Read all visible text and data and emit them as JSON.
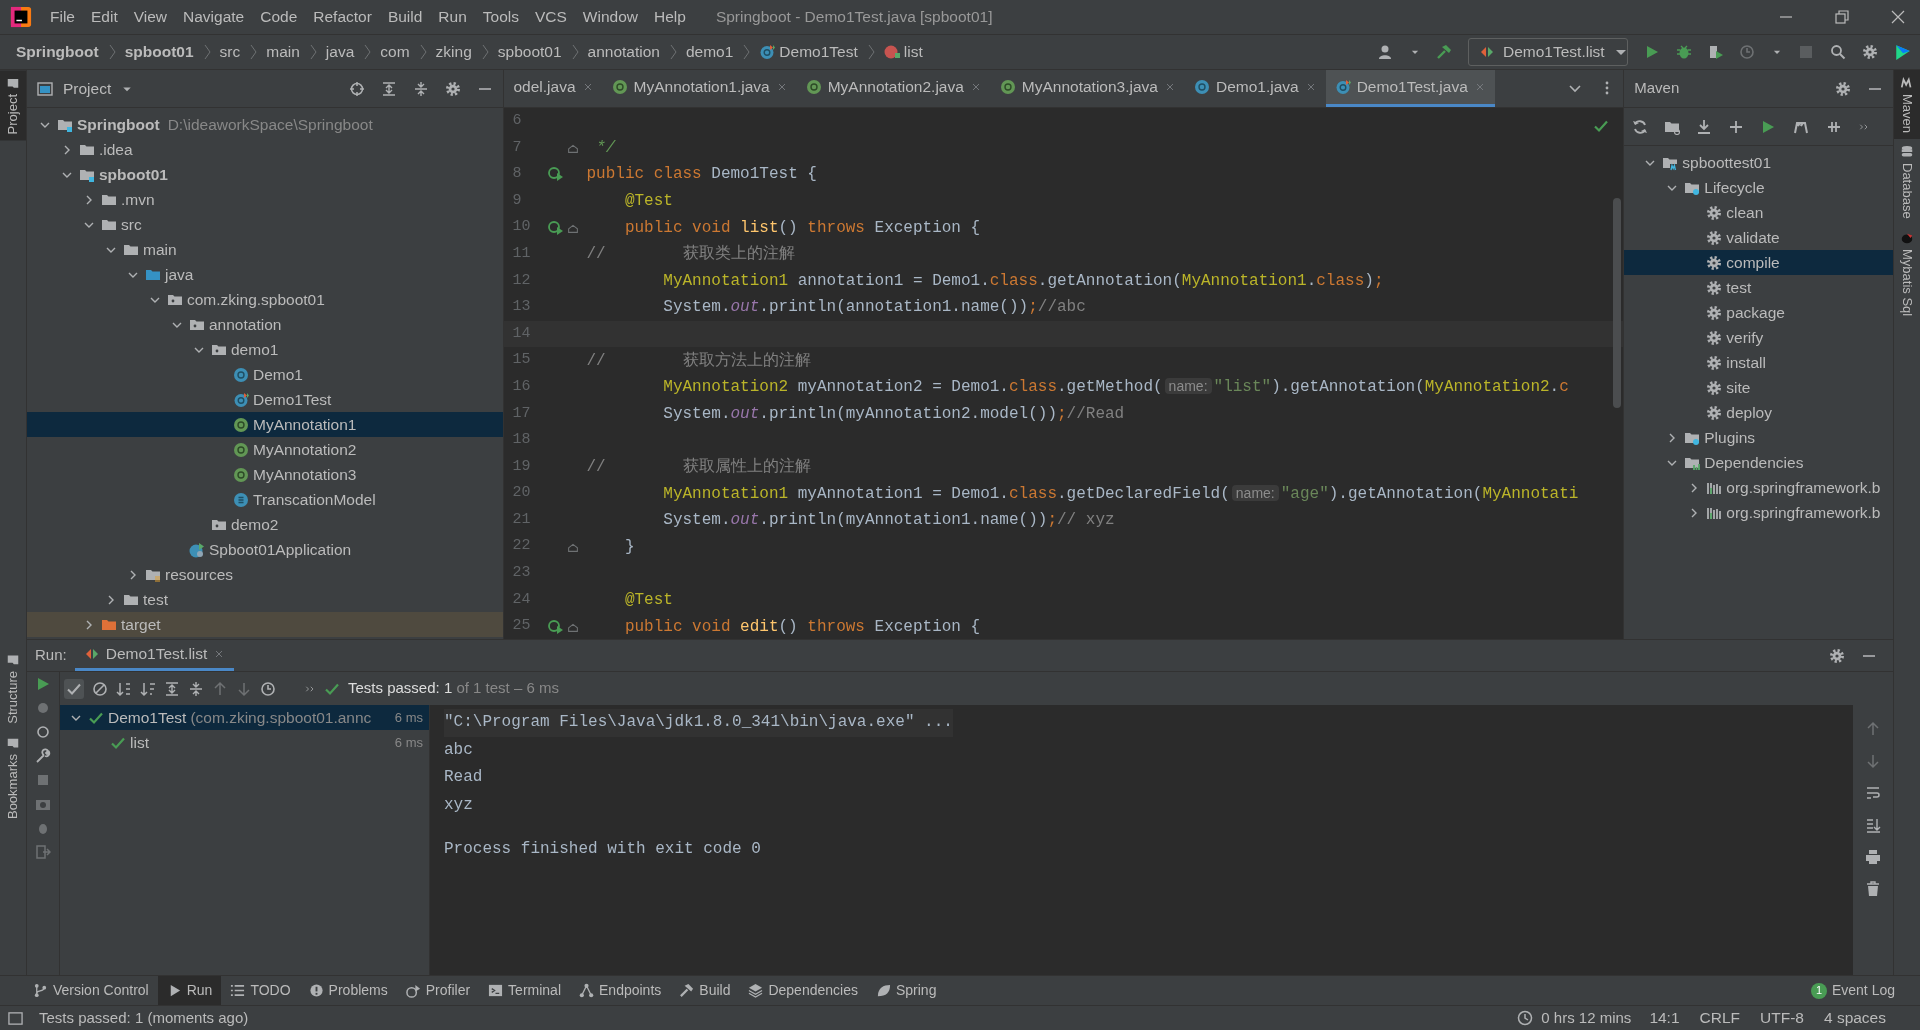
{
  "window": {
    "title": "Springboot - Demo1Test.java [spboot01]"
  },
  "menu": [
    "File",
    "Edit",
    "View",
    "Navigate",
    "Code",
    "Refactor",
    "Build",
    "Run",
    "Tools",
    "VCS",
    "Window",
    "Help"
  ],
  "breadcrumbs": [
    {
      "label": "Springboot",
      "bold": true,
      "kind": "folder"
    },
    {
      "label": "spboot01",
      "bold": true,
      "kind": "folder"
    },
    {
      "label": "src",
      "bold": false,
      "kind": "folder"
    },
    {
      "label": "main",
      "bold": false,
      "kind": "folder"
    },
    {
      "label": "java",
      "bold": false,
      "kind": "folder"
    },
    {
      "label": "com",
      "bold": false,
      "kind": "folder"
    },
    {
      "label": "zking",
      "bold": false,
      "kind": "folder"
    },
    {
      "label": "spboot01",
      "bold": false,
      "kind": "folder"
    },
    {
      "label": "annotation",
      "bold": false,
      "kind": "folder"
    },
    {
      "label": "demo1",
      "bold": false,
      "kind": "folder"
    },
    {
      "label": "Demo1Test",
      "bold": false,
      "kind": "class"
    },
    {
      "label": "list",
      "bold": false,
      "kind": "method"
    }
  ],
  "run_config": {
    "label": "Demo1Test.list"
  },
  "left_stripe": [
    {
      "label": "Project",
      "selected": true
    },
    {
      "label": "Structure",
      "selected": false
    },
    {
      "label": "Bookmarks",
      "selected": false
    }
  ],
  "project": {
    "title": "Project",
    "tree": [
      {
        "label": "Springboot",
        "detail": "D:\\ideaworkSpace\\Springboot",
        "kind": "module",
        "bold": true,
        "expanded": true,
        "selected": false,
        "children": [
          {
            "label": ".idea",
            "kind": "folder",
            "expanded": false,
            "selected": false
          },
          {
            "label": "spboot01",
            "kind": "module",
            "bold": true,
            "expanded": true,
            "selected": false,
            "children": [
              {
                "label": ".mvn",
                "kind": "folder",
                "expanded": false,
                "selected": false
              },
              {
                "label": "src",
                "kind": "folder",
                "expanded": true,
                "selected": false,
                "children": [
                  {
                    "label": "main",
                    "kind": "folder",
                    "expanded": true,
                    "selected": false,
                    "children": [
                      {
                        "label": "java",
                        "kind": "source",
                        "expanded": true,
                        "selected": false,
                        "children": [
                          {
                            "label": "com.zking.spboot01",
                            "kind": "package",
                            "expanded": true,
                            "selected": false,
                            "children": [
                              {
                                "label": "annotation",
                                "kind": "package",
                                "expanded": true,
                                "selected": false,
                                "children": [
                                  {
                                    "label": "demo1",
                                    "kind": "package",
                                    "expanded": true,
                                    "selected": false,
                                    "children": [
                                      {
                                        "label": "Demo1",
                                        "kind": "class",
                                        "selected": false
                                      },
                                      {
                                        "label": "Demo1Test",
                                        "kind": "test-class",
                                        "selected": false
                                      },
                                      {
                                        "label": "MyAnnotation1",
                                        "kind": "annotation",
                                        "selected": true
                                      },
                                      {
                                        "label": "MyAnnotation2",
                                        "kind": "annotation",
                                        "selected": false
                                      },
                                      {
                                        "label": "MyAnnotation3",
                                        "kind": "annotation",
                                        "selected": false
                                      },
                                      {
                                        "label": "TranscationModel",
                                        "kind": "enum",
                                        "selected": false
                                      }
                                    ]
                                  },
                                  {
                                    "label": "demo2",
                                    "kind": "package",
                                    "selected": false
                                  }
                                ]
                              },
                              {
                                "label": "Spboot01Application",
                                "kind": "app",
                                "selected": false
                              }
                            ]
                          }
                        ]
                      },
                      {
                        "label": "resources",
                        "kind": "resources",
                        "expanded": false,
                        "selected": false
                      }
                    ]
                  },
                  {
                    "label": "test",
                    "kind": "folder",
                    "expanded": false,
                    "selected": false
                  }
                ]
              },
              {
                "label": "target",
                "kind": "excluded",
                "expanded": false,
                "selected": false
              }
            ]
          }
        ]
      }
    ]
  },
  "editor": {
    "tabs": [
      {
        "label": "odel.java",
        "kind": "cut",
        "selected": false
      },
      {
        "label": "MyAnnotation1.java",
        "kind": "annotation",
        "selected": false
      },
      {
        "label": "MyAnnotation2.java",
        "kind": "annotation",
        "selected": false
      },
      {
        "label": "MyAnnotation3.java",
        "kind": "annotation",
        "selected": false
      },
      {
        "label": "Demo1.java",
        "kind": "class",
        "selected": false
      },
      {
        "label": "Demo1Test.java",
        "kind": "test-class",
        "selected": true
      }
    ],
    "lines": [
      {
        "number": "6"
      },
      {
        "number": "7",
        "fold": true,
        "tokens": [
          {
            "kind": "doc",
            "text": " */"
          }
        ]
      },
      {
        "number": "8",
        "run": true,
        "tokens": [
          {
            "kind": "keyword",
            "text": "public class "
          },
          {
            "kind": "plain",
            "text": "Demo1Test {"
          }
        ]
      },
      {
        "number": "9",
        "tokens": [
          {
            "kind": "annotation",
            "text": "    @Test"
          }
        ]
      },
      {
        "number": "10",
        "run": true,
        "fold": true,
        "tokens": [
          {
            "kind": "keyword",
            "text": "    public void "
          },
          {
            "kind": "method",
            "text": "list"
          },
          {
            "kind": "plain",
            "text": "() "
          },
          {
            "kind": "keyword",
            "text": "throws "
          },
          {
            "kind": "plain",
            "text": "Exception {"
          }
        ]
      },
      {
        "number": "11",
        "tokens": [
          {
            "kind": "comment",
            "text": "//        获取类上的注解"
          }
        ]
      },
      {
        "number": "12",
        "tokens": [
          {
            "kind": "type",
            "text": "        MyAnnotation1"
          },
          {
            "kind": "plain",
            "text": " annotation1 = Demo1."
          },
          {
            "kind": "keyword",
            "text": "class"
          },
          {
            "kind": "plain",
            "text": ".getAnnotation("
          },
          {
            "kind": "type",
            "text": "MyAnnotation1"
          },
          {
            "kind": "plain",
            "text": "."
          },
          {
            "kind": "keyword",
            "text": "class"
          },
          {
            "kind": "plain",
            "text": ")"
          },
          {
            "kind": "keyword",
            "text": ";"
          }
        ]
      },
      {
        "number": "13",
        "tokens": [
          {
            "kind": "plain",
            "text": "        System."
          },
          {
            "kind": "field",
            "text": "out"
          },
          {
            "kind": "plain",
            "text": ".println(annotation1.name())"
          },
          {
            "kind": "keyword",
            "text": ";"
          },
          {
            "kind": "comment",
            "text": "//abc"
          }
        ]
      },
      {
        "number": "14",
        "current": true
      },
      {
        "number": "15",
        "tokens": [
          {
            "kind": "comment",
            "text": "//        获取方法上的注解"
          }
        ]
      },
      {
        "number": "16",
        "tokens": [
          {
            "kind": "type",
            "text": "        MyAnnotation2"
          },
          {
            "kind": "plain",
            "text": " myAnnotation2 = Demo1."
          },
          {
            "kind": "keyword",
            "text": "class"
          },
          {
            "kind": "plain",
            "text": ".getMethod("
          },
          {
            "kind": "hint",
            "text": "name:"
          },
          {
            "kind": "string",
            "text": "\"list\""
          },
          {
            "kind": "plain",
            "text": ").getAnnotation("
          },
          {
            "kind": "type",
            "text": "MyAnnotation2"
          },
          {
            "kind": "plain",
            "text": "."
          },
          {
            "kind": "keyword",
            "text": "c"
          }
        ]
      },
      {
        "number": "17",
        "tokens": [
          {
            "kind": "plain",
            "text": "        System."
          },
          {
            "kind": "field",
            "text": "out"
          },
          {
            "kind": "plain",
            "text": ".println(myAnnotation2.model())"
          },
          {
            "kind": "keyword",
            "text": ";"
          },
          {
            "kind": "comment",
            "text": "//Read"
          }
        ]
      },
      {
        "number": "18"
      },
      {
        "number": "19",
        "tokens": [
          {
            "kind": "comment",
            "text": "//        获取属性上的注解"
          }
        ]
      },
      {
        "number": "20",
        "tokens": [
          {
            "kind": "type",
            "text": "        MyAnnotation1"
          },
          {
            "kind": "plain",
            "text": " myAnnotation1 = Demo1."
          },
          {
            "kind": "keyword",
            "text": "class"
          },
          {
            "kind": "plain",
            "text": ".getDeclaredField("
          },
          {
            "kind": "hint",
            "text": "name:"
          },
          {
            "kind": "string",
            "text": "\"age\""
          },
          {
            "kind": "plain",
            "text": ").getAnnotation("
          },
          {
            "kind": "type",
            "text": "MyAnnotati"
          }
        ]
      },
      {
        "number": "21",
        "tokens": [
          {
            "kind": "plain",
            "text": "        System."
          },
          {
            "kind": "field",
            "text": "out"
          },
          {
            "kind": "plain",
            "text": ".println(myAnnotation1.name())"
          },
          {
            "kind": "keyword",
            "text": ";"
          },
          {
            "kind": "comment",
            "text": "// xyz"
          }
        ]
      },
      {
        "number": "22",
        "fold": true,
        "tokens": [
          {
            "kind": "plain",
            "text": "    }"
          }
        ]
      },
      {
        "number": "23"
      },
      {
        "number": "24",
        "tokens": [
          {
            "kind": "annotation",
            "text": "    @Test"
          }
        ]
      },
      {
        "number": "25",
        "run": true,
        "fold": true,
        "tokens": [
          {
            "kind": "keyword",
            "text": "    public void "
          },
          {
            "kind": "method",
            "text": "edit"
          },
          {
            "kind": "plain",
            "text": "() "
          },
          {
            "kind": "keyword",
            "text": "throws "
          },
          {
            "kind": "plain",
            "text": "Exception {"
          }
        ]
      }
    ]
  },
  "maven": {
    "title": "Maven",
    "tree": [
      {
        "label": "spboottest01",
        "kind": "maven-module",
        "expanded": true,
        "selected": false,
        "children": [
          {
            "label": "Lifecycle",
            "kind": "lifecycle",
            "expanded": true,
            "selected": false,
            "children": [
              {
                "label": "clean",
                "kind": "goal",
                "selected": false
              },
              {
                "label": "validate",
                "kind": "goal",
                "selected": false
              },
              {
                "label": "compile",
                "kind": "goal",
                "selected": true
              },
              {
                "label": "test",
                "kind": "goal",
                "selected": false
              },
              {
                "label": "package",
                "kind": "goal",
                "selected": false
              },
              {
                "label": "verify",
                "kind": "goal",
                "selected": false
              },
              {
                "label": "install",
                "kind": "goal",
                "selected": false
              },
              {
                "label": "site",
                "kind": "goal",
                "selected": false
              },
              {
                "label": "deploy",
                "kind": "goal",
                "selected": false
              }
            ]
          },
          {
            "label": "Plugins",
            "kind": "lifecycle",
            "expanded": false,
            "selected": false
          },
          {
            "label": "Dependencies",
            "kind": "dependencies",
            "expanded": true,
            "selected": false,
            "children": [
              {
                "label": "org.springframework.b",
                "kind": "library",
                "expanded": false,
                "selected": false
              },
              {
                "label": "org.springframework.b",
                "kind": "library",
                "expanded": false,
                "selected": false
              }
            ]
          }
        ]
      }
    ]
  },
  "right_stripe": [
    {
      "label": "Maven",
      "selected": true,
      "kind": "maven"
    },
    {
      "label": "Database",
      "selected": false,
      "kind": "database"
    },
    {
      "label": "Mybatis Sql",
      "selected": false,
      "kind": "bird"
    }
  ],
  "run": {
    "label": "Run:",
    "tab": "Demo1Test.list",
    "summary": "Tests passed: 1",
    "summary_detail": "of 1 test – 6 ms",
    "tests": [
      {
        "label": "Demo1Test",
        "detail": "(com.zking.spboot01.annc",
        "time": "6 ms",
        "expanded": true,
        "selected": true,
        "children": [
          {
            "label": "list",
            "time": "6 ms",
            "selected": false
          }
        ]
      }
    ],
    "console": [
      {
        "text": "\"C:\\Program Files\\Java\\jdk1.8.0_341\\bin\\java.exe\" ...",
        "kind": "command"
      },
      {
        "text": "abc",
        "kind": "output"
      },
      {
        "text": "Read",
        "kind": "output"
      },
      {
        "text": "xyz",
        "kind": "output"
      },
      {
        "text": "Process finished with exit code 0",
        "kind": "exit"
      }
    ]
  },
  "tool_tabs": [
    {
      "label": "Version Control",
      "kind": "branch",
      "selected": false
    },
    {
      "label": "Run",
      "kind": "play",
      "selected": true
    },
    {
      "label": "TODO",
      "kind": "list",
      "selected": false
    },
    {
      "label": "Problems",
      "kind": "problems",
      "selected": false
    },
    {
      "label": "Profiler",
      "kind": "profiler",
      "selected": false
    },
    {
      "label": "Terminal",
      "kind": "terminal",
      "selected": false
    },
    {
      "label": "Endpoints",
      "kind": "endpoints",
      "selected": false
    },
    {
      "label": "Build",
      "kind": "hammer",
      "selected": false
    },
    {
      "label": "Dependencies",
      "kind": "layers",
      "selected": false
    },
    {
      "label": "Spring",
      "kind": "leaf",
      "selected": false
    }
  ],
  "event_log": {
    "label": "Event Log",
    "count": "1"
  },
  "status_bar": {
    "message": "Tests passed: 1 (moments ago)",
    "timer": "0 hrs 12 mins",
    "items": [
      "14:1",
      "CRLF",
      "UTF-8",
      "4 spaces"
    ]
  }
}
